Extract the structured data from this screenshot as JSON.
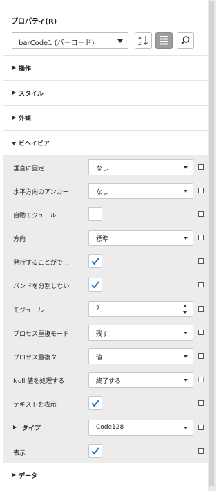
{
  "panel": {
    "title": "プロパティ(R)",
    "object_selector": {
      "value": "barCode1 (バーコード)"
    },
    "toolbar": [
      "sort-az-icon",
      "categorized-icon",
      "search-icon"
    ]
  },
  "sections": [
    {
      "label": "操作",
      "expanded": false
    },
    {
      "label": "スタイル",
      "expanded": false
    },
    {
      "label": "外観",
      "expanded": false
    },
    {
      "label": "ビヘイビア",
      "expanded": true
    },
    {
      "label": "データ",
      "expanded": false
    }
  ],
  "behavior_properties": [
    {
      "label": "垂直に固定",
      "editor": "dropdown",
      "value": "なし"
    },
    {
      "label": "水平方向のアンカー",
      "editor": "dropdown",
      "value": "なし"
    },
    {
      "label": "自動モジュール",
      "editor": "checkbox",
      "checked": false
    },
    {
      "label": "方向",
      "editor": "dropdown",
      "value": "標準"
    },
    {
      "label": "発行することがで...",
      "editor": "checkbox",
      "checked": true
    },
    {
      "label": "バンドを分割しない",
      "editor": "checkbox",
      "checked": true
    },
    {
      "label": "モジュール",
      "editor": "spinner",
      "value": "2"
    },
    {
      "label": "プロセス重複モード",
      "editor": "dropdown",
      "value": "残す"
    },
    {
      "label": "プロセス重複ター...",
      "editor": "dropdown",
      "value": "値"
    },
    {
      "label": "Null 値を処理する",
      "editor": "dropdown",
      "value": "終了する"
    },
    {
      "label": "テキストを表示",
      "editor": "checkbox",
      "checked": true
    },
    {
      "label": "タイプ",
      "editor": "dropdown",
      "value": "Code128",
      "expandable": true
    },
    {
      "label": "表示",
      "editor": "checkbox",
      "checked": true
    }
  ]
}
